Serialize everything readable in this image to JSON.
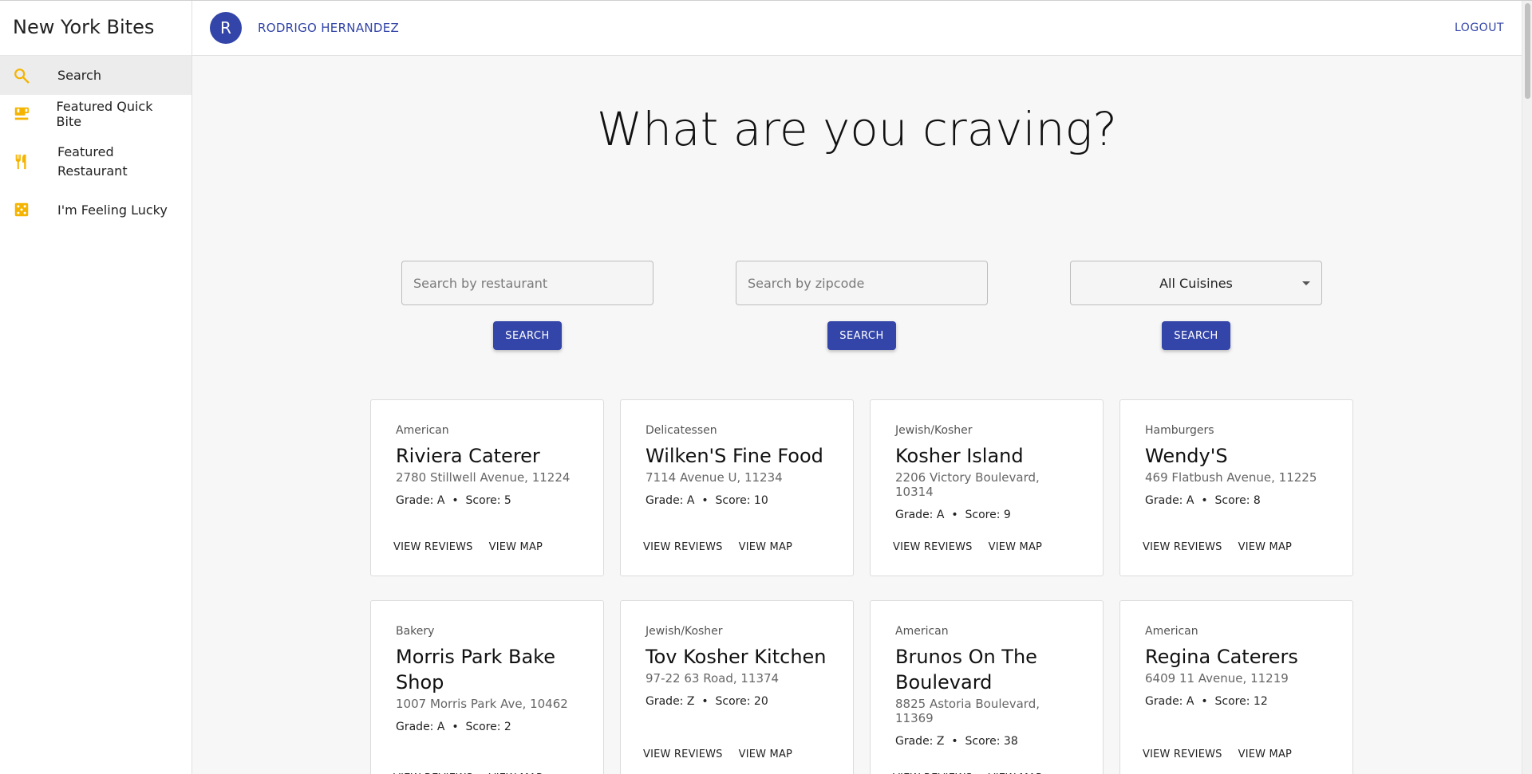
{
  "app": {
    "title": "New York Bites"
  },
  "sidebar": {
    "items": [
      {
        "label": "Search",
        "icon": "search-icon"
      },
      {
        "label": "Featured Quick Bite",
        "icon": "cafe-icon"
      },
      {
        "label": "Featured\nRestaurant",
        "icon": "restaurant-icon"
      },
      {
        "label": "I'm Feeling Lucky",
        "icon": "dice-icon"
      }
    ]
  },
  "header": {
    "avatar_letter": "R",
    "user_name": "RODRIGO HERNANDEZ",
    "logout_label": "LOGOUT"
  },
  "main": {
    "heading": "What are you craving?",
    "search": {
      "restaurant_placeholder": "Search by restaurant",
      "zipcode_placeholder": "Search by zipcode",
      "cuisine_selected": "All Cuisines",
      "button_label": "SEARCH"
    },
    "restaurants": [
      {
        "cuisine": "American",
        "name": "Riviera Caterer",
        "address": "2780 Stillwell Avenue, 11224",
        "grade": "A",
        "score": "5"
      },
      {
        "cuisine": "Delicatessen",
        "name": "Wilken'S Fine Food",
        "address": "7114 Avenue U, 11234",
        "grade": "A",
        "score": "10"
      },
      {
        "cuisine": "Jewish/Kosher",
        "name": "Kosher Island",
        "address": "2206 Victory Boulevard, 10314",
        "grade": "A",
        "score": "9"
      },
      {
        "cuisine": "Hamburgers",
        "name": "Wendy'S",
        "address": "469 Flatbush Avenue, 11225",
        "grade": "A",
        "score": "8"
      },
      {
        "cuisine": "Bakery",
        "name": "Morris Park Bake Shop",
        "address": "1007 Morris Park Ave, 10462",
        "grade": "A",
        "score": "2"
      },
      {
        "cuisine": "Jewish/Kosher",
        "name": "Tov Kosher Kitchen",
        "address": "97-22 63 Road, 11374",
        "grade": "Z",
        "score": "20"
      },
      {
        "cuisine": "American",
        "name": "Brunos On The Boulevard",
        "address": "8825 Astoria Boulevard, 11369",
        "grade": "Z",
        "score": "38"
      },
      {
        "cuisine": "American",
        "name": "Regina Caterers",
        "address": "6409 11 Avenue, 11219",
        "grade": "A",
        "score": "12"
      }
    ],
    "card_labels": {
      "grade": "Grade:",
      "score": "Score:",
      "separator": "•",
      "view_reviews": "VIEW REVIEWS",
      "view_map": "VIEW MAP"
    }
  },
  "colors": {
    "primary": "#3345a8",
    "icon": "#f5b400"
  }
}
